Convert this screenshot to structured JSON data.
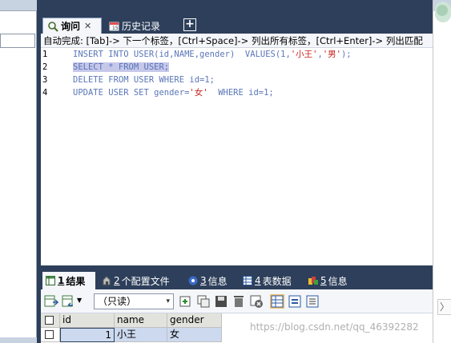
{
  "query_tabs": {
    "active_label": "询问",
    "inactive_label": "历史记录",
    "close_glyph": "✕",
    "add_glyph": "+"
  },
  "hint": "自动完成: [Tab]-> 下一个标签，[Ctrl+Space]-> 列出所有标签，[Ctrl+Enter]-> 列出匹配",
  "editor": {
    "line_numbers": [
      "1",
      "2",
      "3",
      "4"
    ],
    "lines": [
      {
        "before": "INSERT INTO USER(id,NAME,gender)  VALUES(1,",
        "s1": "'小王'",
        "mid": ",",
        "s2": "'男'",
        "after": ");"
      },
      {
        "text": "SELECT * FROM USER;"
      },
      {
        "text": "DELETE FROM USER WHERE id=1;"
      },
      {
        "before": "UPDATE USER SET gender=",
        "s1": "'女'",
        "after": "  WHERE id=1;"
      }
    ]
  },
  "result_tabs": [
    {
      "num": "1",
      "label": "结果",
      "icon": "grid-icon"
    },
    {
      "num": "2",
      "label": "个配置文件",
      "icon": "profile-icon"
    },
    {
      "num": "3",
      "label": "信息",
      "icon": "info-icon"
    },
    {
      "num": "4",
      "label": "表数据",
      "icon": "table-icon"
    },
    {
      "num": "5",
      "label": "信息",
      "icon": "message-icon"
    }
  ],
  "toolbar": {
    "mode_select": "（只读）",
    "select_arrow": "▾"
  },
  "grid": {
    "columns": [
      "id",
      "name",
      "gender"
    ],
    "rows": [
      {
        "id": "1",
        "name": "小王",
        "gender": "女"
      }
    ]
  },
  "watermark": "https://blog.csdn.net/qq_46392282",
  "right_chevron": "〉",
  "colors": {
    "dark_chrome": "#2d3f5a",
    "keyword_blue": "#5a76b8",
    "string_red": "#c8221f",
    "selection": "#c6c8ea"
  }
}
